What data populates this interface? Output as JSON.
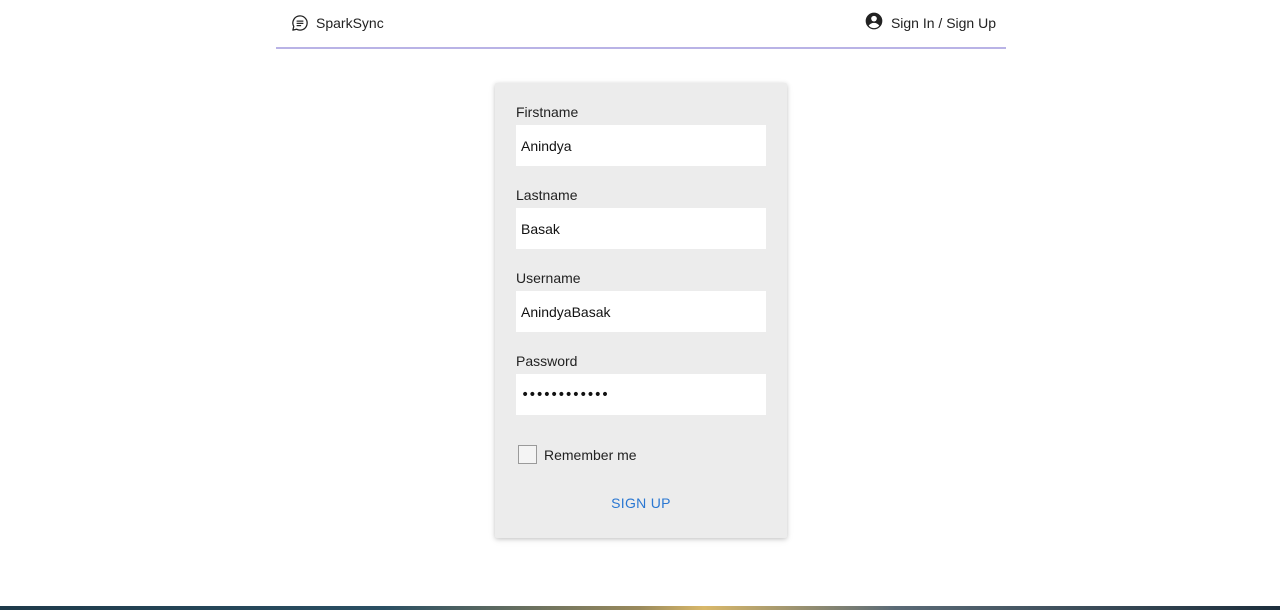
{
  "navbar": {
    "brand_name": "SparkSync",
    "brand_icon": "chat-bubble-icon",
    "auth_label": "Sign In / Sign Up",
    "auth_icon": "account-circle-icon",
    "border_color": "#b9b3e6"
  },
  "form": {
    "fields": [
      {
        "label": "Firstname",
        "value": "Anindya"
      },
      {
        "label": "Lastname",
        "value": "Basak"
      },
      {
        "label": "Username",
        "value": "AnindyaBasak"
      },
      {
        "label": "Password",
        "value": "••••••••••••"
      }
    ],
    "remember_label": "Remember me",
    "remember_checked": false,
    "submit_label": "SIGN UP",
    "accent_color": "#2a77d2"
  }
}
